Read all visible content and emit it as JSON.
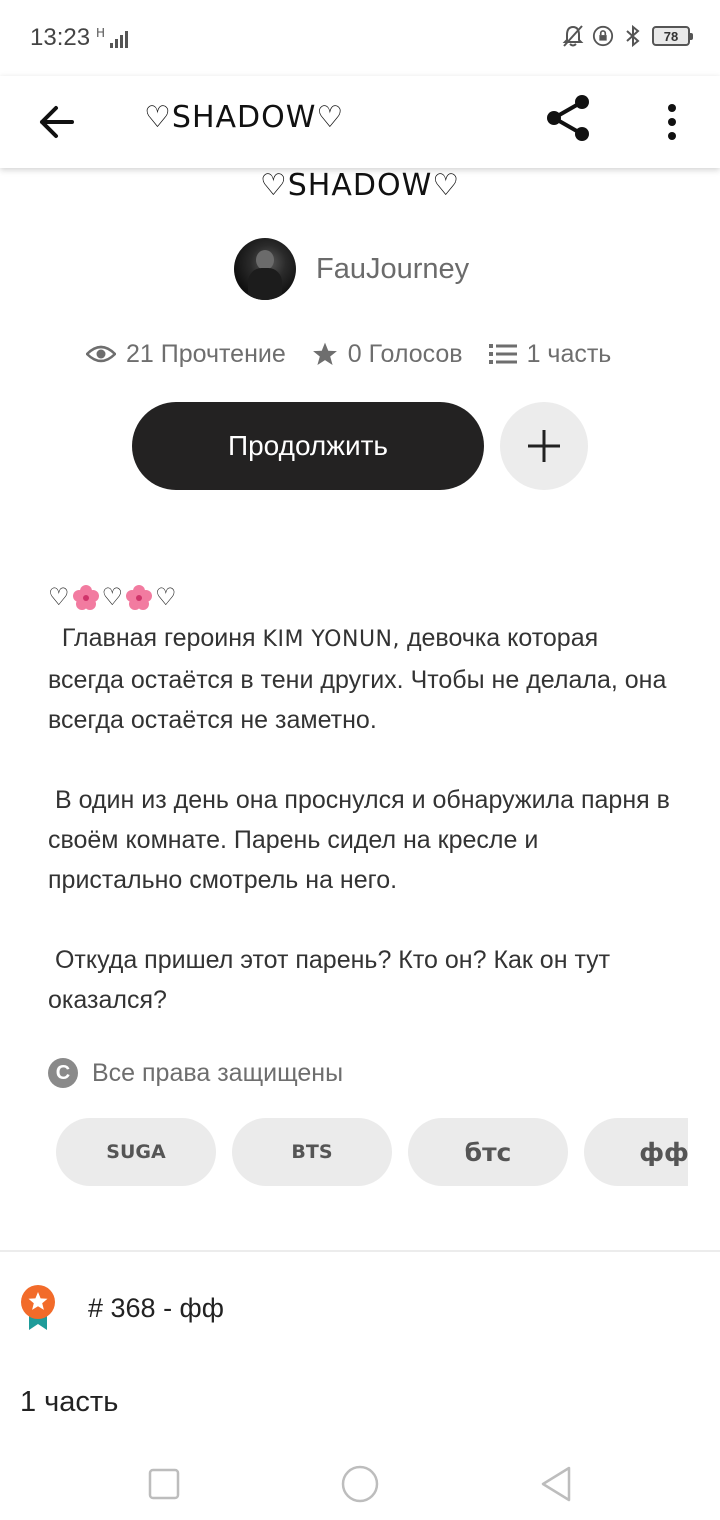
{
  "status_bar": {
    "time": "13:23",
    "network": "H",
    "battery": "78"
  },
  "app_bar": {
    "title": "♡SHADOW♡",
    "icons": [
      "back-arrow-icon",
      "share-icon",
      "more-vert-icon"
    ]
  },
  "story": {
    "title": "♡SHADOW♡",
    "author": "FauJourney",
    "stats": {
      "reads": "21 Прочтение",
      "votes": "0 Голосов",
      "parts": "1 часть"
    },
    "continue_label": "Продолжить",
    "description": {
      "hearts": [
        "♡",
        "♡",
        "♡"
      ],
      "p1_before": "  Главная героиня ",
      "p1_name": "KIM YONUN,",
      "p1_after": " девочка которая всегда остаётся в тени других. Чтобы не делала, она всегда остаётся не заметно.",
      "p2": " В один из день она проснулся и обнаружила парня в своём комнате. Парень сидел на кресле и пристально смотрель на него.",
      "p3": " Откуда пришел этот парень? Кто он? Как он тут оказался?"
    },
    "rights": "Все права защищены",
    "tags": [
      "SUGA",
      "BTS",
      "бтс",
      "фф"
    ],
    "ranking": "# 368 - фф",
    "parts_header": "1 часть"
  },
  "colors": {
    "button_dark": "#232222",
    "tag_bg": "#ebebeb",
    "rank_orange": "#f26b2a",
    "rank_teal": "#1e9c9a"
  }
}
